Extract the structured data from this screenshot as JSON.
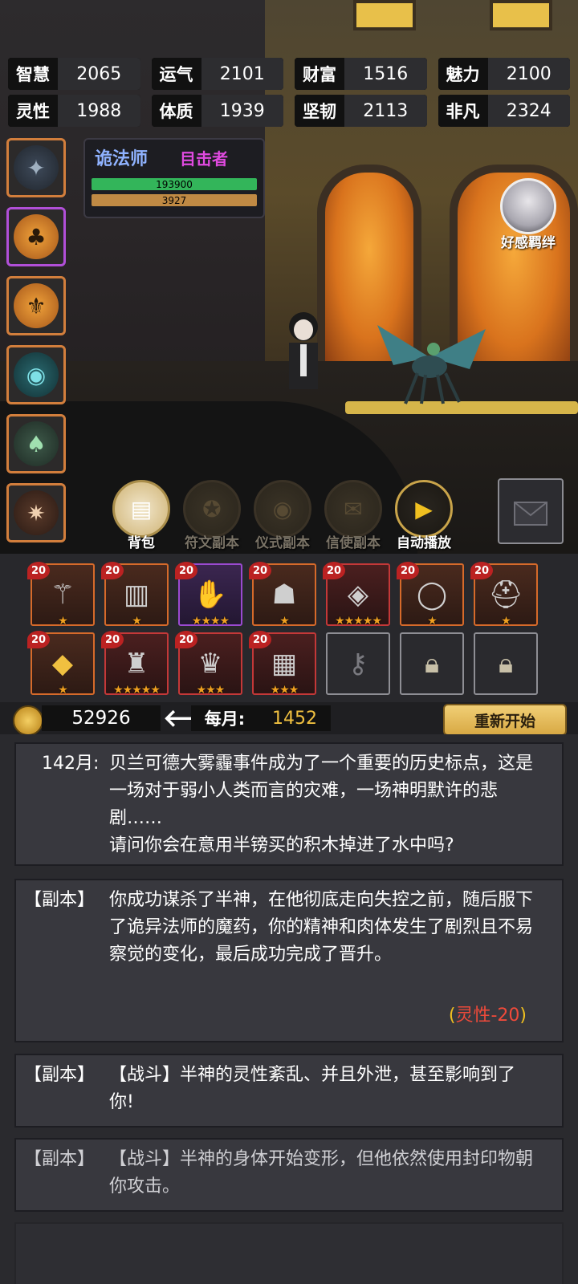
{
  "stats": [
    {
      "label": "智慧",
      "value": "2065"
    },
    {
      "label": "运气",
      "value": "2101"
    },
    {
      "label": "财富",
      "value": "1516"
    },
    {
      "label": "魅力",
      "value": "2100"
    },
    {
      "label": "灵性",
      "value": "1988"
    },
    {
      "label": "体质",
      "value": "1939"
    },
    {
      "label": "坚韧",
      "value": "2113"
    },
    {
      "label": "非凡",
      "value": "2324"
    }
  ],
  "character": {
    "name": "诡法师",
    "title": "目击者",
    "hp": "193900",
    "mp": "3927"
  },
  "affinity_label": "好感羁绊",
  "actions": [
    {
      "label": "背包"
    },
    {
      "label": "符文副本"
    },
    {
      "label": "仪式副本"
    },
    {
      "label": "信使副本"
    },
    {
      "label": "自动播放"
    }
  ],
  "inventory": [
    {
      "level": "20",
      "stars": "★"
    },
    {
      "level": "20",
      "stars": "★"
    },
    {
      "level": "20",
      "stars": "★★★★"
    },
    {
      "level": "20",
      "stars": "★"
    },
    {
      "level": "20",
      "stars": "★★★★★"
    },
    {
      "level": "20",
      "stars": "★"
    },
    {
      "level": "20",
      "stars": "★"
    },
    {
      "level": "20",
      "stars": "★"
    },
    {
      "level": "20",
      "stars": "★★★★★"
    },
    {
      "level": "20",
      "stars": "★★★"
    },
    {
      "level": "20",
      "stars": "★★★"
    }
  ],
  "currency": {
    "money": "52926",
    "monthly_label": "每月:",
    "monthly_value": "1452",
    "restart": "重新开始"
  },
  "log": [
    {
      "head": "142月:",
      "body": "贝兰可德大雾霾事件成为了一个重要的历史标点，这是一场对于弱小人类而言的灾难，一场神明默许的悲剧……\n请问你会在意用半镑买的积木掉进了水中吗?"
    },
    {
      "head": "【副本】",
      "body": "你成功谋杀了半神，在他彻底走向失控之前，随后服下了诡异法师的魔药，你的精神和肉体发生了剧烈且不易察觉的变化，最后成功完成了晋升。",
      "note": "灵性-20"
    },
    {
      "head": "【副本】",
      "body": "【战斗】半神的灵性紊乱、并且外泄，甚至影响到了你!"
    },
    {
      "head": "【副本】",
      "body": "【战斗】半神的身体开始变形，但他依然使用封印物朝你攻击。"
    }
  ]
}
